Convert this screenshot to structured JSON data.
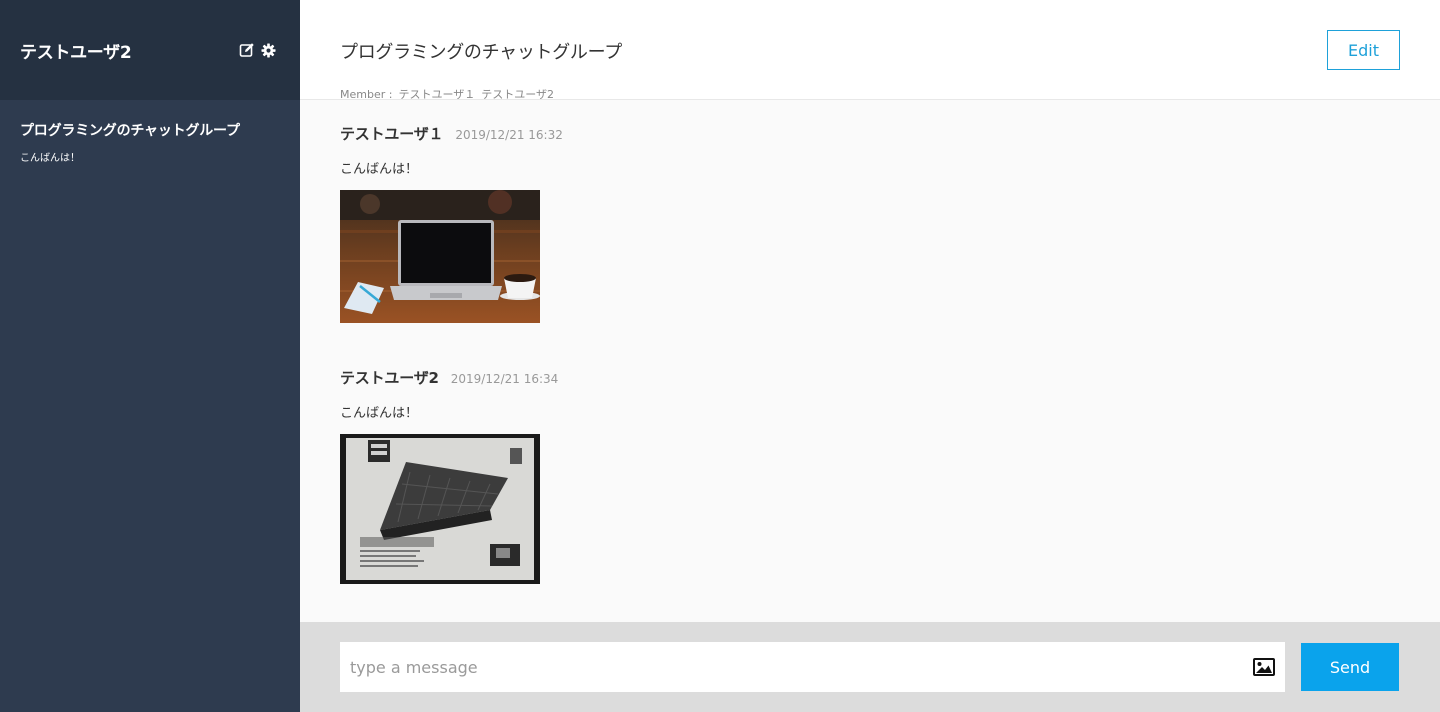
{
  "sidebar": {
    "user_name": "テストユーザ2",
    "groups": [
      {
        "name": "プログラミングのチャットグループ",
        "last_message": "こんばんは！"
      }
    ]
  },
  "header": {
    "title": "プログラミングのチャットグループ",
    "members_label": "Member :",
    "members": [
      "テストユーザ１",
      "テストユーザ2"
    ],
    "edit_label": "Edit"
  },
  "messages": [
    {
      "user": "テストユーザ１",
      "time": "2019/12/21 16:32",
      "text": "こんばんは！",
      "image": "laptop-on-wooden-table-photo"
    },
    {
      "user": "テストユーザ2",
      "time": "2019/12/21 16:34",
      "text": "こんばんは！",
      "image": "ergostand-box-photo"
    }
  ],
  "footer": {
    "placeholder": "type a message",
    "send_label": "Send"
  },
  "colors": {
    "sidebar_bg": "#2e3b4f",
    "sidebar_header_bg": "#253141",
    "accent": "#1ea1d9",
    "send_button": "#0aa3ec"
  }
}
